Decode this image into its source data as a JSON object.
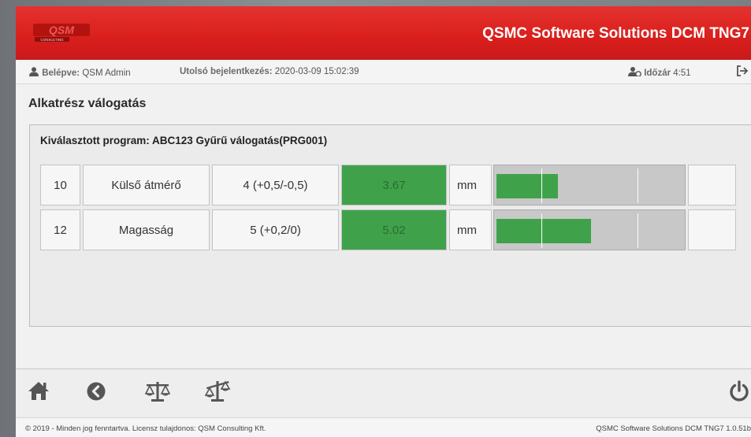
{
  "header": {
    "logo_text": "QSM",
    "logo_subtext": "CONSULTING",
    "app_title": "QSMC Software Solutions DCM TNG7"
  },
  "infobar": {
    "user_label": "Belépve:",
    "user_value": "QSM Admin",
    "last_login_label": "Utolsó bejelentkezés:",
    "last_login_value": "2020-03-09 15:02:39",
    "timer_label": "Időzár",
    "timer_value": "4:51"
  },
  "page": {
    "title": "Alkatrész válogatás",
    "program_label": "Kiválasztott program:",
    "program_value": "ABC123 Gyűrű válogatás(PRG001)"
  },
  "rows": [
    {
      "id": "10",
      "name": "Külső átmérő",
      "nominal": "4 (+0,5/-0,5)",
      "value": "3.67",
      "unit": "mm",
      "fill": 0.33
    },
    {
      "id": "12",
      "name": "Magasság",
      "nominal": "5 (+0,2/0)",
      "value": "5.02",
      "unit": "mm",
      "fill": 0.51
    }
  ],
  "bottom_icons": [
    "home-icon",
    "back-icon",
    "balance-scale-icon",
    "unbalanced-scale-icon",
    "power-icon"
  ],
  "footer": {
    "copyright": "© 2019 - Minden jog fenntartva. Licensz tulajdonos: QSM Consulting Kft.",
    "version": "QSMC Software Solutions DCM TNG7 1.0.51b"
  },
  "colors": {
    "brand_red": "#d91f1c",
    "value_green": "#3fa24a",
    "gauge_gray": "#c8c8c8"
  }
}
